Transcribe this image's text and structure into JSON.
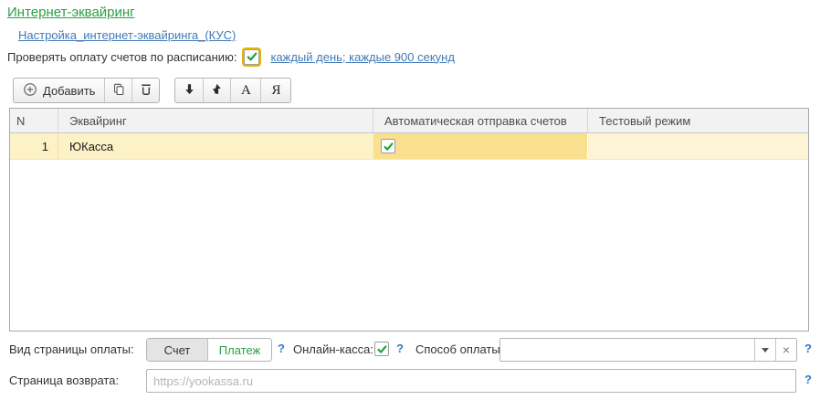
{
  "header": {
    "title": "Интернет-эквайринг",
    "settings_link": "Настройка_интернет-эквайринга_(КУС)"
  },
  "schedule": {
    "label": "Проверять оплату счетов по расписанию:",
    "checked": true,
    "schedule_link": "каждый день; каждые 900 секунд"
  },
  "toolbar": {
    "add_label": "Добавить",
    "sort_asc_label": "А",
    "sort_desc_label": "Я"
  },
  "table": {
    "columns": [
      "N",
      "Эквайринг",
      "Автоматическая отправка счетов",
      "Тестовый режим"
    ],
    "rows": [
      {
        "n": "1",
        "acquiring": "ЮКасса",
        "auto_send_checked": true,
        "test_mode": ""
      }
    ]
  },
  "footer": {
    "payment_page_kind_label": "Вид страницы оплаты:",
    "invoice_option": "Счет",
    "payment_option": "Платеж",
    "online_kassa_label": "Онлайн-касса:",
    "online_kassa_checked": true,
    "payment_method_label": "Способ оплаты:",
    "payment_method_value": "",
    "return_page_label": "Страница возврата:",
    "return_page_placeholder": "https://yookassa.ru",
    "help_glyph": "?"
  },
  "colors": {
    "accent_green": "#2b9e46",
    "link_blue": "#4179b8",
    "help_blue": "#2d7cc7",
    "check_green": "#1fa038",
    "focus_yellow": "#e8b400",
    "row_highlight": "#fdf1c6",
    "selected_cell": "#f9e08e"
  }
}
